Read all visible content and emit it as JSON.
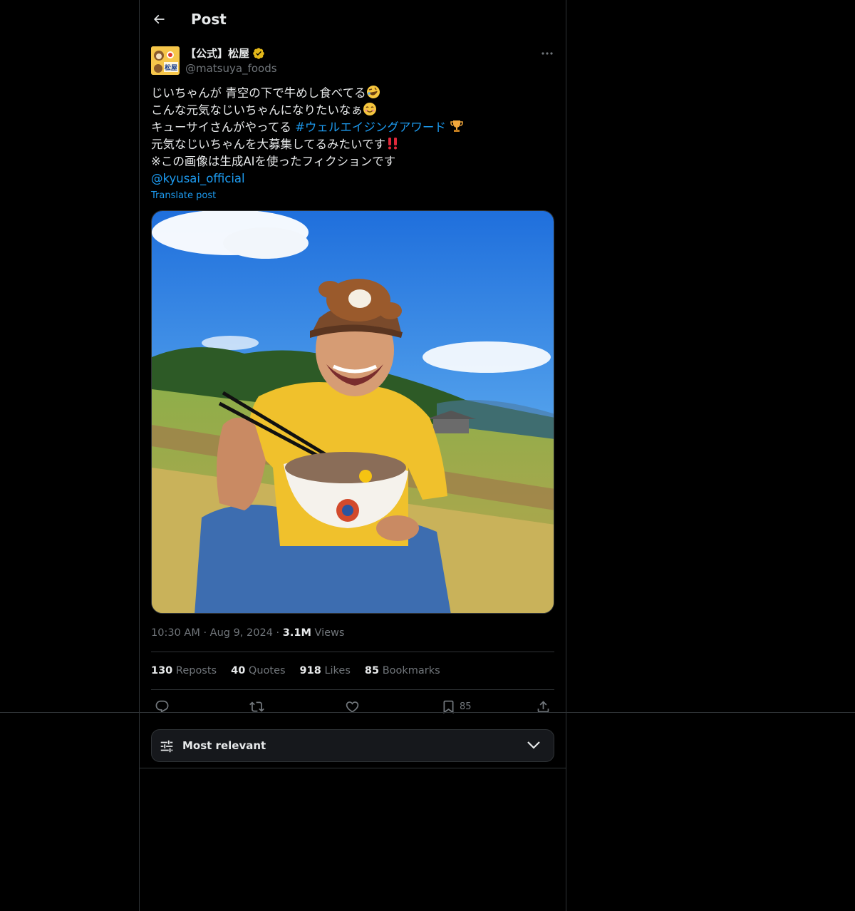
{
  "header": {
    "title": "Post"
  },
  "author": {
    "display_name": "【公式】松屋",
    "handle": "@matsuya_foods",
    "verified": true,
    "avatar_text": "松屋"
  },
  "post": {
    "lines": [
      "じいちゃんが 青空の下で牛めし食べてる",
      "こんな元気なじいちゃんになりたいなぁ",
      "キューサイさんがやってる ",
      "元気なじいちゃんを大募集してるみたいです",
      "※この画像は生成AIを使ったフィクションです"
    ],
    "hashtag": "#ウェルエイジングアワード",
    "mention": "@kyusai_official",
    "translate_label": "Translate post"
  },
  "meta": {
    "time": "10:30 AM",
    "date": "Aug 9, 2024",
    "views_count": "3.1M",
    "views_label": "Views"
  },
  "stats": [
    {
      "count": "130",
      "label": "Reposts"
    },
    {
      "count": "40",
      "label": "Quotes"
    },
    {
      "count": "918",
      "label": "Likes"
    },
    {
      "count": "85",
      "label": "Bookmarks"
    }
  ],
  "actions": {
    "bookmark_count": "85"
  },
  "sort": {
    "label": "Most relevant"
  },
  "colors": {
    "accent": "#1d9bf0",
    "text": "#e7e9ea",
    "muted": "#71767b",
    "border": "#2f3336",
    "verified": "#e2b719"
  }
}
